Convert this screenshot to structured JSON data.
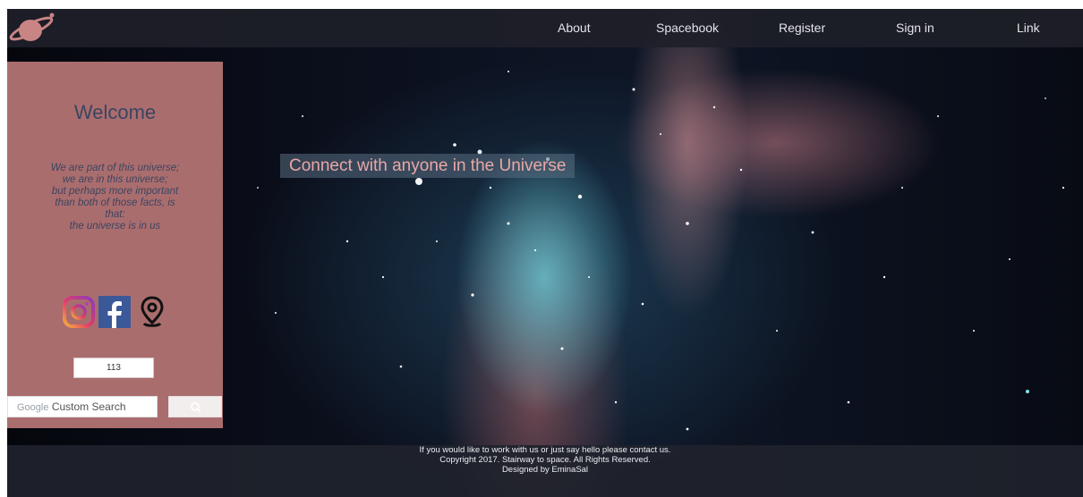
{
  "nav": {
    "items": [
      "About",
      "Spacebook",
      "Register",
      "Sign in",
      "Link"
    ]
  },
  "sidebar": {
    "welcome": "Welcome",
    "quote_lines": [
      "We are part of this universe;",
      "we are in this universe;",
      "but perhaps more important",
      "than both of those facts, is",
      "that:",
      "the universe is in us"
    ],
    "social_icons": [
      "instagram-icon",
      "facebook-icon",
      "location-pin-icon"
    ],
    "counter": "113",
    "search": {
      "brand": "Google",
      "placeholder": "Custom Search"
    }
  },
  "hero": {
    "tagline": "Connect with anyone in the Universe"
  },
  "footer": {
    "lines": [
      "If you would like to work with us or just say hello please contact us.",
      "Copyright 2017. Stairway to space. All Rights Reserved.",
      "Designed by EminaSal"
    ]
  },
  "colors": {
    "navbar": "#1e2028",
    "sidebar": "#b87676",
    "tagline": "#e9a7a7",
    "welcome_text": "#3b4560",
    "footer": "#20232c"
  }
}
